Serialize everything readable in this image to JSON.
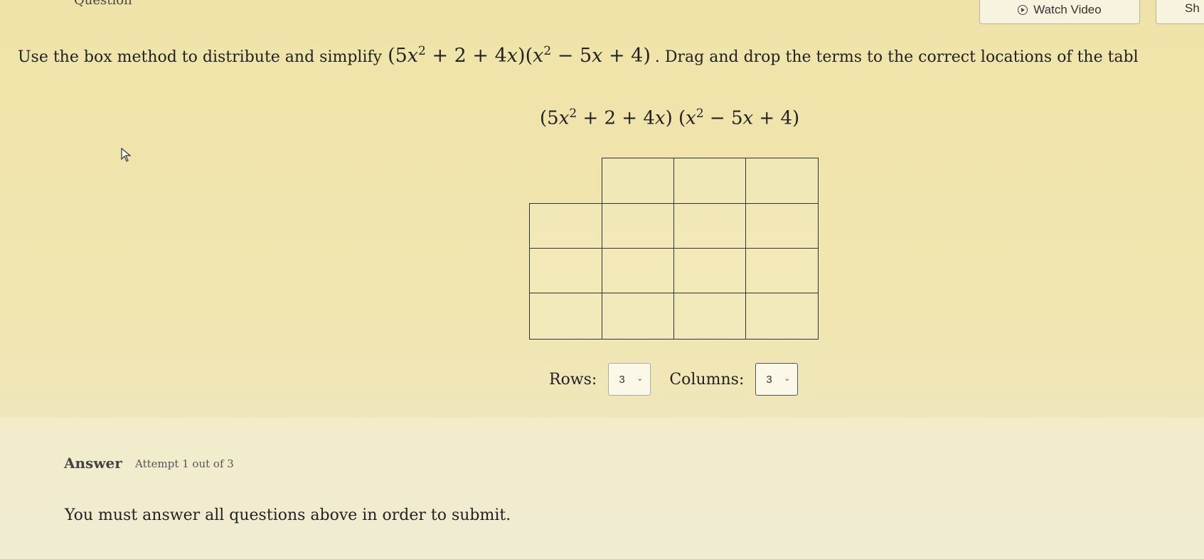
{
  "header": {
    "question_label": "Question",
    "watch_video_label": "Watch Video",
    "show_label": "Sh"
  },
  "question": {
    "prompt_prefix": "Use the box method to distribute and simplify",
    "prompt_suffix": ". Drag and drop the terms to the correct locations of the tabl"
  },
  "expression": "(5x² + 2 + 4x)(x² − 5x + 4)",
  "grid": {
    "rows": 3,
    "columns": 3
  },
  "controls": {
    "rows_label": "Rows:",
    "rows_value": "3",
    "columns_label": "Columns:",
    "columns_value": "3"
  },
  "answer": {
    "title": "Answer",
    "attempt": "Attempt 1 out of 3",
    "message": "You must answer all questions above in order to submit."
  },
  "icons": [
    "play-circle-icon",
    "chevron-down-icon",
    "mouse-cursor-icon"
  ]
}
